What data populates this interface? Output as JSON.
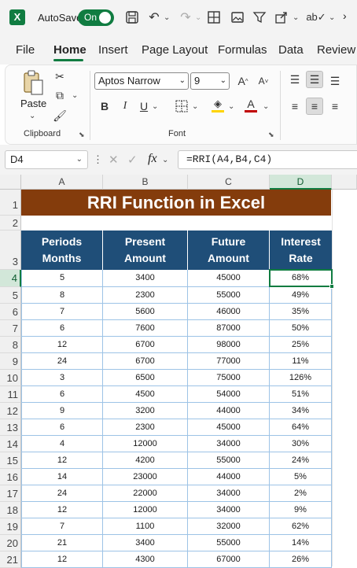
{
  "titlebar": {
    "autosave_label": "AutoSave",
    "autosave_state": "On"
  },
  "tabs": [
    "File",
    "Home",
    "Insert",
    "Page Layout",
    "Formulas",
    "Data",
    "Review"
  ],
  "active_tab": "Home",
  "ribbon": {
    "clipboard": {
      "paste_label": "Paste",
      "group_label": "Clipboard"
    },
    "font": {
      "font_name": "Aptos Narrow",
      "font_size": "9",
      "bold": "B",
      "italic": "I",
      "grow": "A^",
      "shrink": "A˅",
      "font_color": "A",
      "group_label": "Font"
    }
  },
  "formula_bar": {
    "name_box": "D4",
    "fx": "fx",
    "formula": "=RRI(A4,B4,C4)"
  },
  "sheet": {
    "columns": [
      "A",
      "B",
      "C",
      "D"
    ],
    "selected_column": "D",
    "rows": [
      "1",
      "2",
      "3",
      "4",
      "5",
      "6",
      "7",
      "8",
      "9",
      "10",
      "11",
      "12",
      "13",
      "14",
      "15",
      "16",
      "17",
      "18",
      "19",
      "20",
      "21"
    ],
    "selected_row": "4",
    "title": "RRI Function in Excel",
    "headers": [
      [
        "Periods",
        "Months"
      ],
      [
        "Present",
        "Amount"
      ],
      [
        "Future",
        "Amount"
      ],
      [
        "Interest",
        "Rate"
      ]
    ],
    "data": [
      [
        "5",
        "3400",
        "45000",
        "68%"
      ],
      [
        "8",
        "2300",
        "55000",
        "49%"
      ],
      [
        "7",
        "5600",
        "46000",
        "35%"
      ],
      [
        "6",
        "7600",
        "87000",
        "50%"
      ],
      [
        "12",
        "6700",
        "98000",
        "25%"
      ],
      [
        "24",
        "6700",
        "77000",
        "11%"
      ],
      [
        "3",
        "6500",
        "75000",
        "126%"
      ],
      [
        "6",
        "4500",
        "54000",
        "51%"
      ],
      [
        "9",
        "3200",
        "44000",
        "34%"
      ],
      [
        "6",
        "2300",
        "45000",
        "64%"
      ],
      [
        "4",
        "12000",
        "34000",
        "30%"
      ],
      [
        "12",
        "4200",
        "55000",
        "24%"
      ],
      [
        "14",
        "23000",
        "44000",
        "5%"
      ],
      [
        "24",
        "22000",
        "34000",
        "2%"
      ],
      [
        "12",
        "12000",
        "34000",
        "9%"
      ],
      [
        "7",
        "1100",
        "32000",
        "62%"
      ],
      [
        "21",
        "3400",
        "55000",
        "14%"
      ],
      [
        "12",
        "4300",
        "67000",
        "26%"
      ]
    ]
  },
  "colors": {
    "excel_green": "#107c41",
    "title_fill": "#843c0c",
    "header_fill": "#1f4e78",
    "table_border": "#9dc3e6"
  }
}
